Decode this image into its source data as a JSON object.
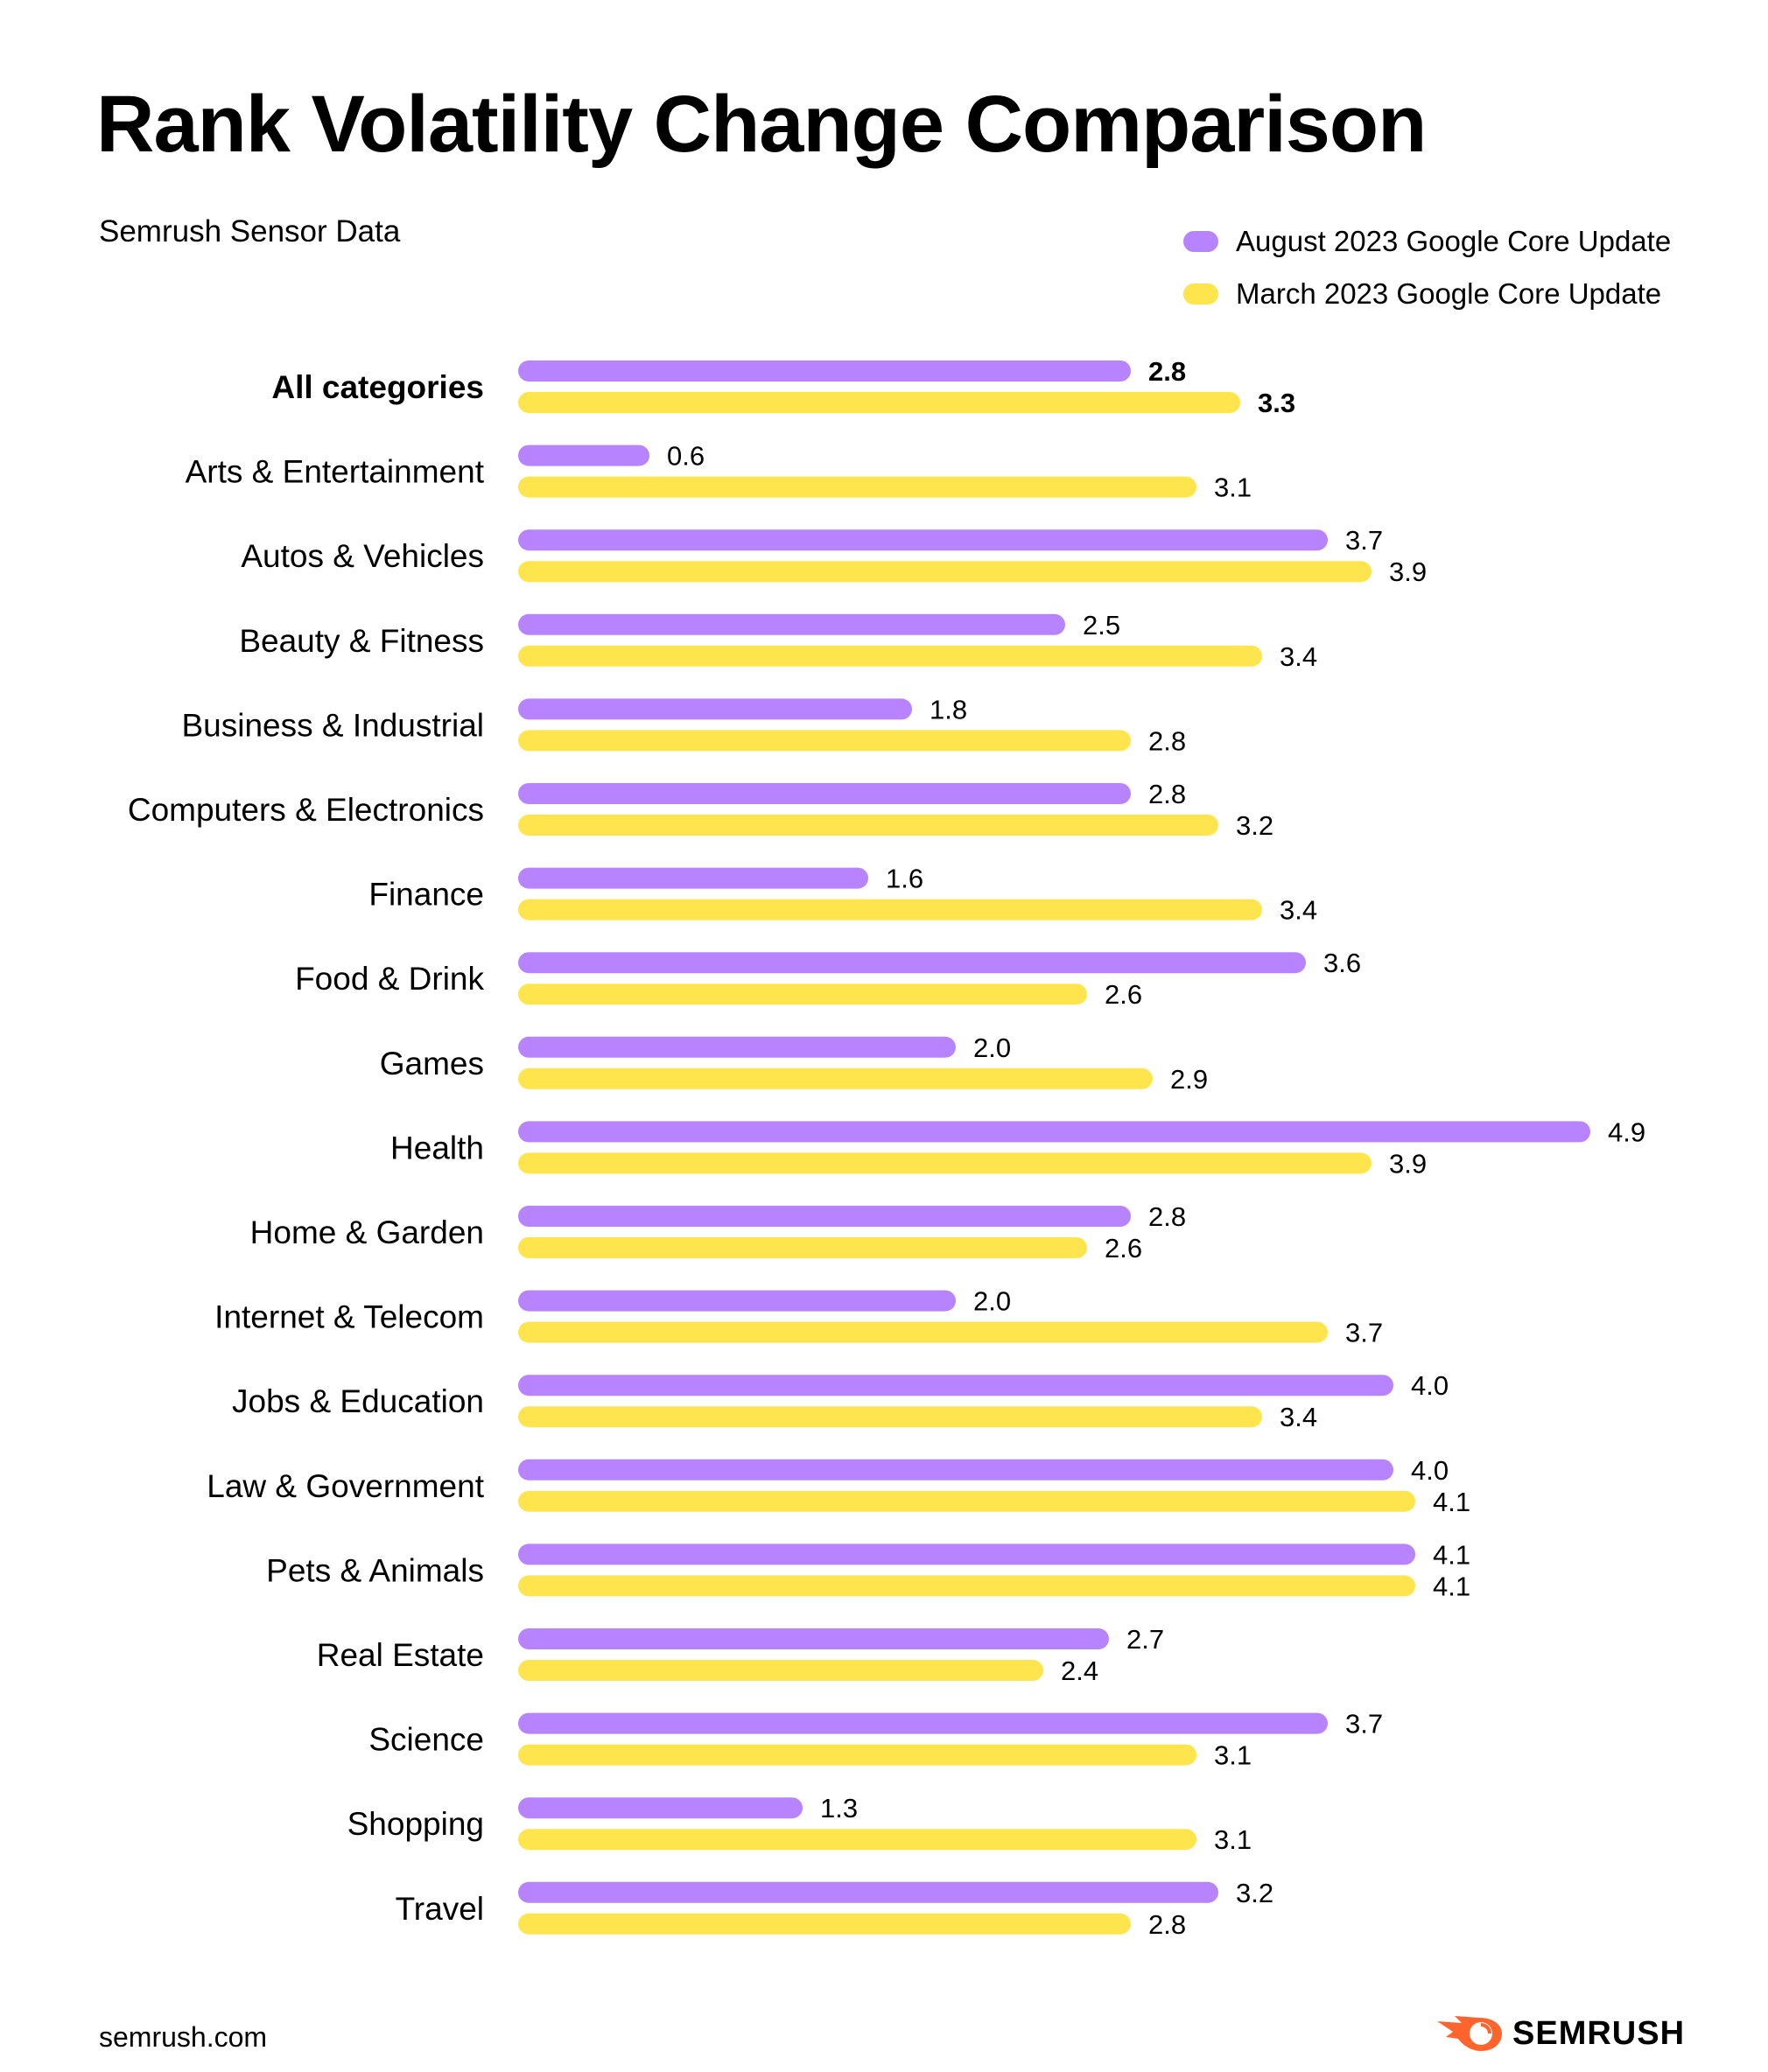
{
  "header": {
    "title": "Rank Volatility Change Comparison",
    "subtitle": "Semrush Sensor Data"
  },
  "legend": [
    {
      "label": "August 2023 Google Core Update",
      "color": "#B883FF"
    },
    {
      "label": "March 2023 Google Core Update",
      "color": "#FFE54D"
    }
  ],
  "footer": {
    "url": "semrush.com",
    "logo_text": "SEMRUSH",
    "logo_icon": "semrush-fireball-icon",
    "logo_color": "#FF642D"
  },
  "chart_data": {
    "type": "bar",
    "orientation": "horizontal",
    "title": "Rank Volatility Change Comparison",
    "subtitle": "Semrush Sensor Data",
    "xlabel": "",
    "ylabel": "",
    "xlim": [
      0,
      4.9
    ],
    "grid": false,
    "legend_position": "top-right",
    "highlight_category": "All categories",
    "categories": [
      "All categories",
      "Arts & Entertainment",
      "Autos & Vehicles",
      "Beauty & Fitness",
      "Business & Industrial",
      "Computers & Electronics",
      "Finance",
      "Food & Drink",
      "Games",
      "Health",
      "Home & Garden",
      "Internet & Telecom",
      "Jobs & Education",
      "Law & Government",
      "Pets & Animals",
      "Real Estate",
      "Science",
      "Shopping",
      "Travel"
    ],
    "series": [
      {
        "name": "August 2023 Google Core Update",
        "color": "#B883FF",
        "values": [
          2.8,
          0.6,
          3.7,
          2.5,
          1.8,
          2.8,
          1.6,
          3.6,
          2.0,
          4.9,
          2.8,
          2.0,
          4.0,
          4.0,
          4.1,
          2.7,
          3.7,
          1.3,
          3.2
        ],
        "labels": [
          "2.8",
          "0.6",
          "3.7",
          "2.5",
          "1.8",
          "2.8",
          "1.6",
          "3.6",
          "2.0",
          "4.9",
          "2.8",
          "2.0",
          "4.0",
          "4.0",
          "4.1",
          "2.7",
          "3.7",
          "1.3",
          "3.2"
        ]
      },
      {
        "name": "March 2023 Google Core Update",
        "color": "#FFE54D",
        "values": [
          3.3,
          3.1,
          3.9,
          3.4,
          2.8,
          3.2,
          3.4,
          2.6,
          2.9,
          3.9,
          2.6,
          3.7,
          3.4,
          4.1,
          4.1,
          2.4,
          3.1,
          3.1,
          2.8
        ],
        "labels": [
          "3.3",
          "3.1",
          "3.9",
          "3.4",
          "2.8",
          "3.2",
          "3.4",
          "2.6",
          "2.9",
          "3.9",
          "2.6",
          "3.7",
          "3.4",
          "4.1",
          "4.1",
          "2.4",
          "3.1",
          "3.1",
          "2.8"
        ]
      }
    ]
  }
}
